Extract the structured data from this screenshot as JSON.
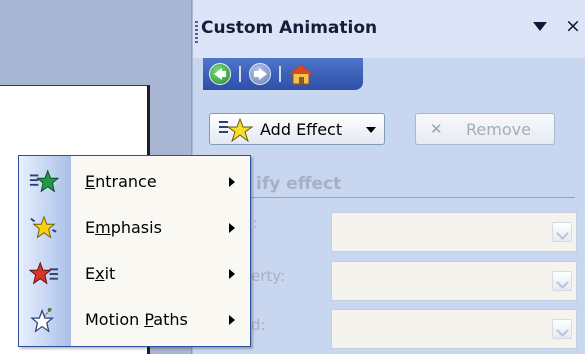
{
  "task_pane": {
    "title": "Custom Animation",
    "close_glyph": "×"
  },
  "nav": {
    "back_icon": "back-arrow-icon",
    "forward_icon": "forward-arrow-icon",
    "home_icon": "home-icon"
  },
  "toolbar": {
    "add_effect_label": "Add Effect",
    "remove_label": "Remove"
  },
  "modify": {
    "heading_visible": "ify effect",
    "fields": [
      {
        "label_visible": ":"
      },
      {
        "label_visible": "erty:"
      },
      {
        "label_visible": "d:"
      }
    ]
  },
  "add_effect_menu": {
    "items": [
      {
        "label_pre": "",
        "label_u": "E",
        "label_post": "ntrance",
        "icon": "entrance-star-icon",
        "color": "#1f9b4a"
      },
      {
        "label_pre": "E",
        "label_u": "m",
        "label_post": "phasis",
        "icon": "emphasis-star-icon",
        "color": "#f5d20e"
      },
      {
        "label_pre": "E",
        "label_u": "x",
        "label_post": "it",
        "icon": "exit-star-icon",
        "color": "#d8342a"
      },
      {
        "label_pre": "Motion ",
        "label_u": "P",
        "label_post": "aths",
        "icon": "motion-paths-star-icon",
        "color": "#ffffff"
      }
    ]
  },
  "colors": {
    "nav_bar": "#2d4fa8",
    "pane_bg": "#c9d6ef",
    "menu_border": "#2f4f9e"
  }
}
